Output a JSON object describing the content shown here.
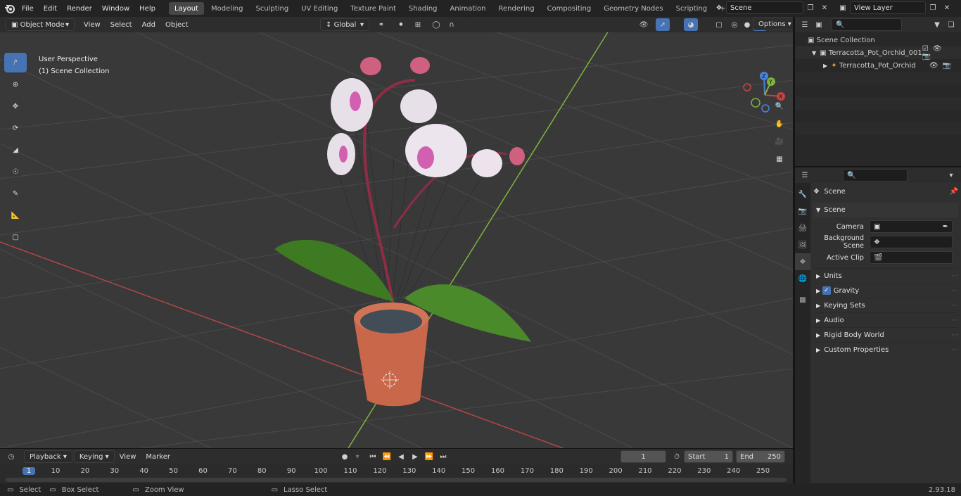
{
  "topbar": {
    "menus": [
      "File",
      "Edit",
      "Render",
      "Window",
      "Help"
    ],
    "workspaces": [
      "Layout",
      "Modeling",
      "Sculpting",
      "UV Editing",
      "Texture Paint",
      "Shading",
      "Animation",
      "Rendering",
      "Compositing",
      "Geometry Nodes",
      "Scripting"
    ],
    "active_workspace": "Layout",
    "add_tab": "+",
    "scene_name": "Scene",
    "view_layer": "View Layer"
  },
  "viewport": {
    "mode": "Object Mode",
    "menus": [
      "View",
      "Select",
      "Add",
      "Object"
    ],
    "orientation": "Global",
    "options": "Options",
    "info_line1": "User Perspective",
    "info_line2": "(1) Scene Collection",
    "gizmo": {
      "x": "X",
      "y": "Y",
      "z": "Z"
    }
  },
  "outliner": {
    "root": "Scene Collection",
    "items": [
      {
        "label": "Terracotta_Pot_Orchid_001",
        "depth": 1
      },
      {
        "label": "Terracotta_Pot_Orchid",
        "depth": 2
      }
    ]
  },
  "properties": {
    "header": "Scene",
    "section": "Scene",
    "fields": [
      {
        "label": "Camera"
      },
      {
        "label": "Background Scene"
      },
      {
        "label": "Active Clip"
      }
    ],
    "subpanels": [
      "Units",
      "Gravity",
      "Keying Sets",
      "Audio",
      "Rigid Body World",
      "Custom Properties"
    ],
    "gravity_checked": true
  },
  "timeline": {
    "menus": [
      "Playback",
      "Keying",
      "View",
      "Marker"
    ],
    "current_frame": "1",
    "start_label": "Start",
    "start": "1",
    "end_label": "End",
    "end": "250",
    "ruler": [
      "1",
      "10",
      "20",
      "30",
      "40",
      "50",
      "60",
      "70",
      "80",
      "90",
      "100",
      "110",
      "120",
      "130",
      "140",
      "150",
      "160",
      "170",
      "180",
      "190",
      "200",
      "210",
      "220",
      "230",
      "240",
      "250"
    ]
  },
  "statusbar": {
    "items": [
      "Select",
      "Box Select",
      "Zoom View",
      "Lasso Select"
    ],
    "version": "2.93.18"
  },
  "colors": {
    "accent": "#4772b3",
    "x_axis": "#c44545",
    "y_axis": "#7fb33c",
    "z_axis": "#4a83d8"
  }
}
